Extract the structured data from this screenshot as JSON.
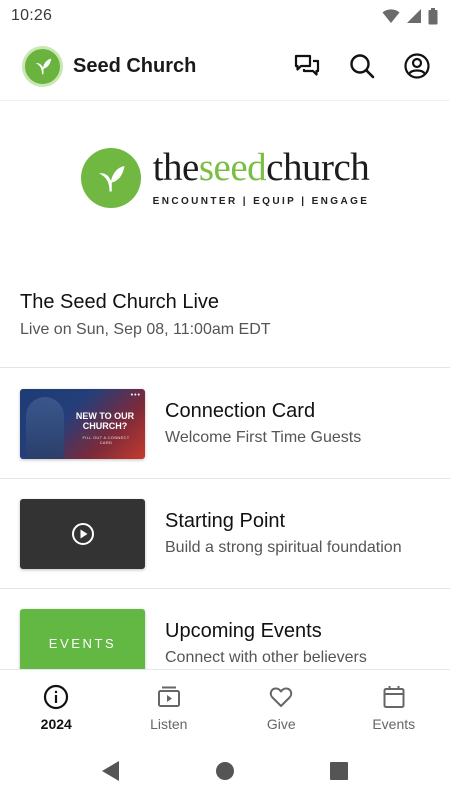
{
  "status_bar": {
    "time": "10:26",
    "icons": [
      "wifi-icon",
      "cellular-signal-icon",
      "battery-icon"
    ]
  },
  "header": {
    "app_name": "Seed Church",
    "actions": [
      "chat-icon",
      "search-icon",
      "account-icon"
    ]
  },
  "banner": {
    "wordmark_prefix": "the",
    "wordmark_highlight": "seed",
    "wordmark_suffix": "church",
    "tagline": "ENCOUNTER | EQUIP | ENGAGE"
  },
  "live": {
    "title": "The Seed Church Live",
    "subtitle": "Live on Sun, Sep 08, 11:00am EDT"
  },
  "items": [
    {
      "title": "Connection Card",
      "subtitle": "Welcome First Time Guests",
      "thumb_text": "NEW TO OUR CHURCH?",
      "thumb_subtext": "FILL OUT A CONNECT CARD"
    },
    {
      "title": "Starting Point",
      "subtitle": "Build a strong spiritual foundation",
      "thumb_icon": "play-circle-icon"
    },
    {
      "title": "Upcoming Events",
      "subtitle": "Connect with other believers",
      "thumb_text": "EVENTS"
    }
  ],
  "bottom_nav": [
    {
      "label": "2024",
      "icon": "info-icon",
      "active": true
    },
    {
      "label": "Listen",
      "icon": "video-library-icon",
      "active": false
    },
    {
      "label": "Give",
      "icon": "heart-icon",
      "active": false
    },
    {
      "label": "Events",
      "icon": "calendar-icon",
      "active": false
    }
  ],
  "colors": {
    "brand_green": "#6ab33f",
    "events_green": "#62b843",
    "text_primary": "#111111",
    "text_secondary": "#555555"
  }
}
